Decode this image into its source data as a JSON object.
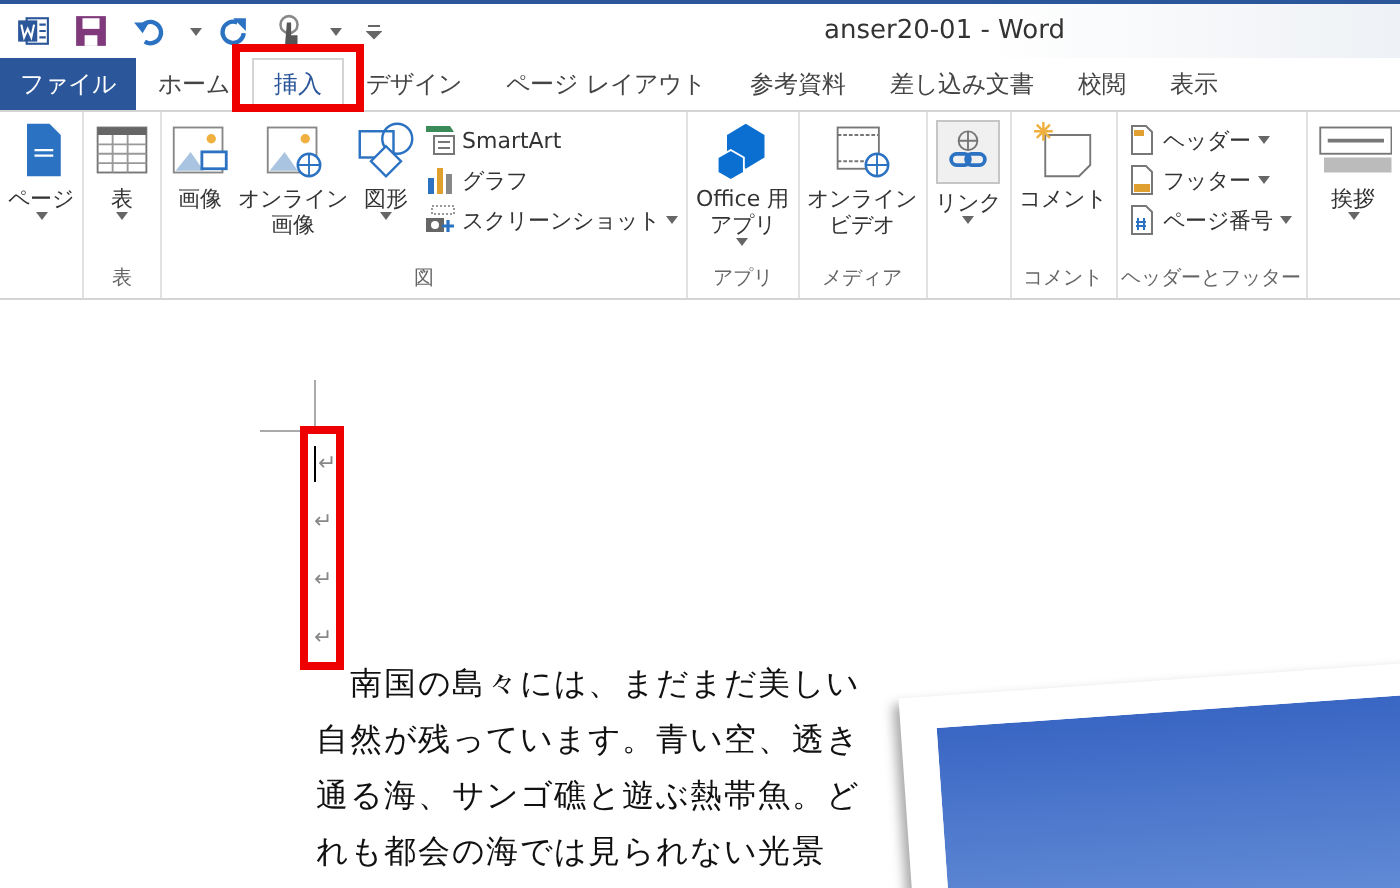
{
  "window": {
    "title": "anser20-01 - Word"
  },
  "tabs": [
    {
      "label": "ファイル",
      "kind": "file",
      "selected": false
    },
    {
      "label": "ホーム",
      "kind": "tab",
      "selected": false
    },
    {
      "label": "挿入",
      "kind": "tab",
      "selected": true
    },
    {
      "label": "デザイン",
      "kind": "tab",
      "selected": false
    },
    {
      "label": "ページ レイアウト",
      "kind": "tab",
      "selected": false
    },
    {
      "label": "参考資料",
      "kind": "tab",
      "selected": false
    },
    {
      "label": "差し込み文書",
      "kind": "tab",
      "selected": false
    },
    {
      "label": "校閲",
      "kind": "tab",
      "selected": false
    },
    {
      "label": "表示",
      "kind": "tab",
      "selected": false
    }
  ],
  "ribbon": {
    "groups": [
      {
        "items": [
          {
            "label": "ページ",
            "kind": "large",
            "dropdown": true
          }
        ]
      },
      {
        "label": "表",
        "items": [
          {
            "label": "表",
            "kind": "large",
            "dropdown": true
          }
        ]
      },
      {
        "label": "図",
        "items": [
          {
            "label": "画像",
            "kind": "large",
            "dropdown": false
          },
          {
            "label": [
              "オンライン",
              "画像"
            ],
            "kind": "large",
            "dropdown": false
          },
          {
            "label": "図形",
            "kind": "large",
            "dropdown": true
          },
          {
            "label": "SmartArt",
            "kind": "small",
            "dropdown": false
          },
          {
            "label": "グラフ",
            "kind": "small",
            "dropdown": false
          },
          {
            "label": "スクリーンショット",
            "kind": "small",
            "dropdown": true
          }
        ]
      },
      {
        "label": "アプリ",
        "items": [
          {
            "label": [
              "Office 用",
              "アプリ"
            ],
            "kind": "large",
            "dropdown": true
          }
        ]
      },
      {
        "label": "メディア",
        "items": [
          {
            "label": [
              "オンライン",
              "ビデオ"
            ],
            "kind": "large",
            "dropdown": false
          }
        ]
      },
      {
        "items": [
          {
            "label": "リンク",
            "kind": "large",
            "dropdown": true
          }
        ]
      },
      {
        "label": "コメント",
        "items": [
          {
            "label": "コメント",
            "kind": "large",
            "dropdown": false
          }
        ]
      },
      {
        "label": "ヘッダーとフッター",
        "items": [
          {
            "label": "ヘッダー",
            "kind": "small",
            "dropdown": true
          },
          {
            "label": "フッター",
            "kind": "small",
            "dropdown": true
          },
          {
            "label": "ページ番号",
            "kind": "small",
            "dropdown": true
          }
        ]
      },
      {
        "items": [
          {
            "label": "挨拶",
            "kind": "large",
            "dropdown": true
          }
        ]
      }
    ]
  },
  "document": {
    "paragraph_marks": [
      {
        "mark": "↵",
        "cursor": true
      },
      {
        "mark": "↵",
        "cursor": false
      },
      {
        "mark": "↵",
        "cursor": false
      },
      {
        "mark": "↵",
        "cursor": false
      }
    ],
    "body_lines": [
      "　南国の島々には、まだまだ美しい",
      "自然が残っています。青い空、透き",
      "通る海、サンゴ礁と遊ぶ熱帯魚。ど",
      "れも都会の海では見られない光景"
    ]
  }
}
